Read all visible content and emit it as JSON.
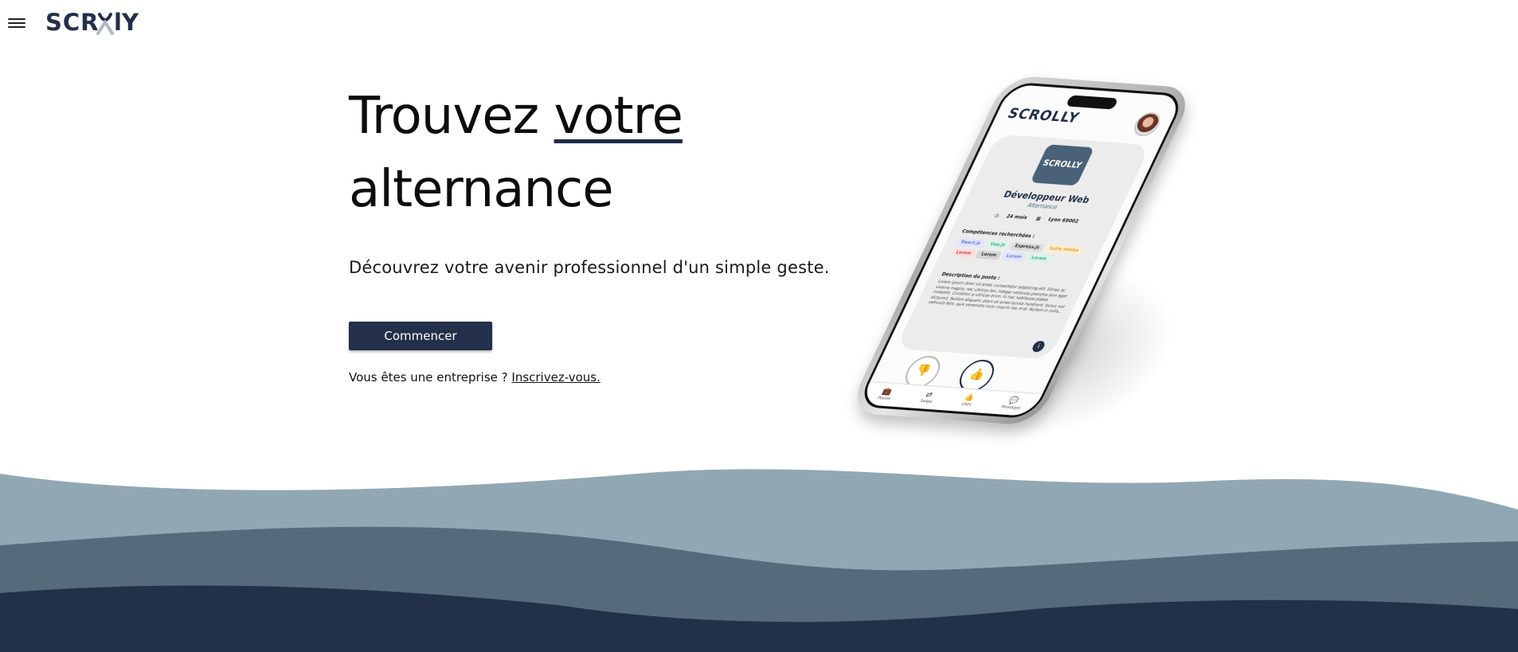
{
  "header": {
    "menu_icon": "hamburger-menu-icon",
    "logo_text": "SCROLLY"
  },
  "hero": {
    "headline_part1": "Trouvez ",
    "headline_underlined": "votre",
    "headline_part2": "alternance",
    "subtitle": "Découvrez votre avenir professionnel d'un simple geste.",
    "cta_label": "Commencer",
    "company_prompt": "Vous êtes une entreprise ?",
    "company_link": "Inscrivez-vous."
  },
  "phone": {
    "app_logo": "SCROLLY",
    "card_logo": "SCROLLY",
    "job_title": "Développeur Web",
    "job_type": "Alternance",
    "duration": "24 mois",
    "location": "Lyon 69002",
    "skills_heading": "Compétences recherchées :",
    "skills": [
      {
        "label": "React.js",
        "color": "#6c7cf0",
        "bg": "#e3e6fb"
      },
      {
        "label": "Vue.js",
        "color": "#3bb58a",
        "bg": "#dcf3ea"
      },
      {
        "label": "Express.js",
        "color": "#333333",
        "bg": "#dcdcdc"
      },
      {
        "label": "Suite Adobe",
        "color": "#f0a030",
        "bg": "#fbeed6"
      },
      {
        "label": "Lorem",
        "color": "#e84545",
        "bg": "#fbe0e0"
      },
      {
        "label": "Lorem",
        "color": "#333333",
        "bg": "#d5d5d5"
      },
      {
        "label": "Lorem",
        "color": "#6c7cf0",
        "bg": "#e3e6fb"
      },
      {
        "label": "Lorem",
        "color": "#3bb58a",
        "bg": "#dcf3ea"
      }
    ],
    "description_heading": "Description du poste :",
    "description": "Lorem ipsum dolor sit amet, consectetur adipiscing elit. Donec ac viverra magna, nec ultrices leo. Integer vehicula pharetra sem eget molestie. Curabitur a ultrices enim. In hac habitasse platea dictumst. Nullam aliquam, diam sit amet lacinia hendrerit, lectus nisl vehicula felis, quis venenatis nunc mauris nec erat. Nullam in nulla...",
    "info_label": "i",
    "tabs": [
      {
        "icon": "briefcase-icon",
        "label": "Postes"
      },
      {
        "icon": "swipe-icon",
        "label": "Swipe"
      },
      {
        "icon": "thumbs-up-icon",
        "label": "Likes"
      },
      {
        "icon": "chat-icon",
        "label": "Messages"
      }
    ]
  },
  "colors": {
    "primary": "#22304a",
    "wave_light": "#91a8b4",
    "wave_mid": "#556a7b",
    "wave_dark": "#22304a"
  }
}
